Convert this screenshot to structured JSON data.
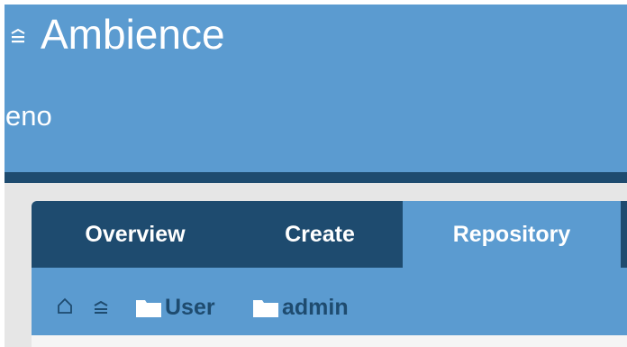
{
  "app": {
    "title": "Ambience"
  },
  "user": {
    "name": "eno"
  },
  "tabs": [
    {
      "label": "Overview",
      "active": false
    },
    {
      "label": "Create",
      "active": false
    },
    {
      "label": "Repository",
      "active": true
    }
  ],
  "breadcrumb": {
    "icons": [
      "home-icon",
      "list-icon"
    ],
    "items": [
      {
        "label": "User",
        "icon": "folder-icon"
      },
      {
        "label": "admin",
        "icon": "folder-icon"
      }
    ]
  },
  "colors": {
    "header": "#5b9bd0",
    "dark": "#1e4b6f",
    "content_bg": "#e6e6e6",
    "text_light": "#ffffff"
  }
}
